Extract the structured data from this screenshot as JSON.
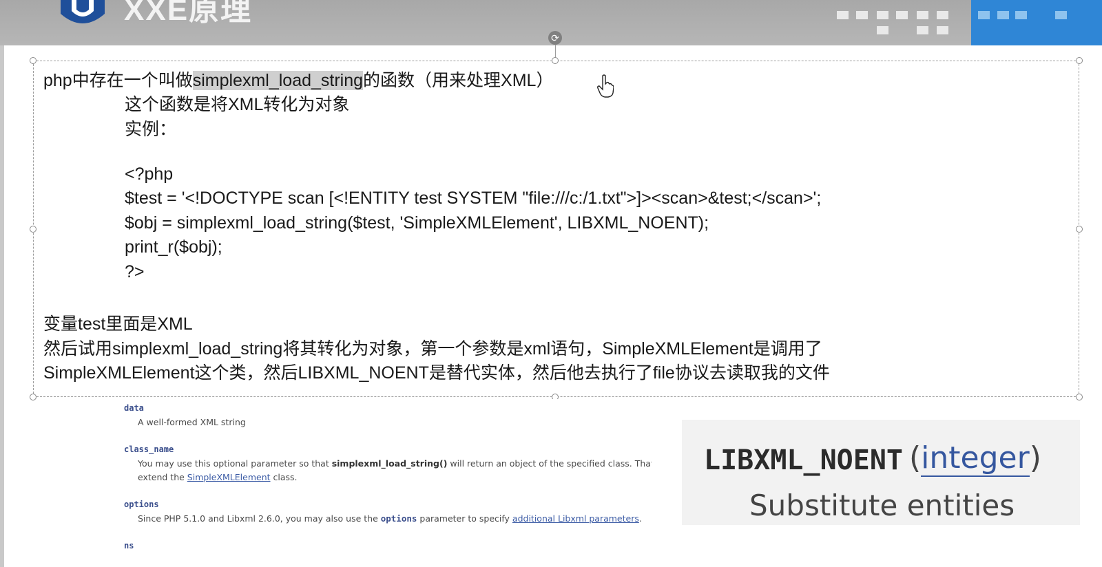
{
  "header": {
    "title": "XXE原理",
    "colors": {
      "banner": "#b0b0b0",
      "accent": "#2f86d6"
    }
  },
  "slide": {
    "intro": {
      "prefix": "php中存在一个叫做",
      "function": "simplexml_load_string",
      "suffix": "的函数（用来处理XML）"
    },
    "desc": "这个函数是将XML转化为对象",
    "example_label": "实例：",
    "code": [
      "<?php",
      "$test = '<!DOCTYPE scan [<!ENTITY test SYSTEM \"file:///c:/1.txt\">]><scan>&test;</scan>';",
      "$obj = simplexml_load_string($test, 'SimpleXMLElement', LIBXML_NOENT);",
      "print_r($obj);",
      "?>"
    ],
    "explanation": [
      "变量test里面是XML",
      "然后试用simplexml_load_string将其转化为对象，第一个参数是xml语句，SimpleXMLElement是调用了",
      "SimpleXMLElement这个类，然后LIBXML_NOENT是替代实体，然后他去执行了file协议去读取我的文件"
    ]
  },
  "doc": {
    "data_term": "data",
    "data_desc": "A well-formed XML string",
    "class_term": "class_name",
    "class_desc_1": "You may use this optional parameter so that ",
    "class_desc_fn": "simplexml_load_string()",
    "class_desc_2": " will return an object of the specified class. That clas",
    "class_desc_3": "extend the ",
    "class_desc_link": "SimpleXMLElement",
    "class_desc_4": " class.",
    "options_term": "options",
    "options_desc_1": "Since PHP 5.1.0 and Libxml 2.6.0, you may also use the ",
    "options_desc_code": "options",
    "options_desc_2": " parameter to specify ",
    "options_desc_link": "additional Libxml parameters",
    "options_desc_3": ".",
    "next_term": "ns"
  },
  "constant_card": {
    "name": "LIBXML_NOENT",
    "open_paren": "(",
    "type": "integer",
    "close_paren": ")",
    "description": "Substitute entities"
  }
}
